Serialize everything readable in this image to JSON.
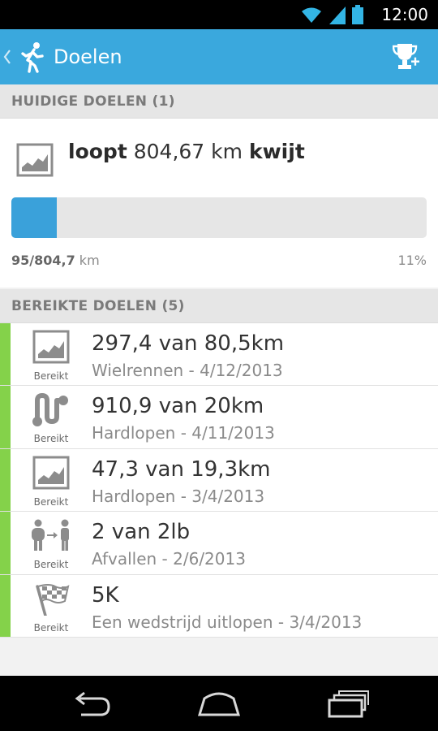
{
  "status_bar": {
    "time": "12:00"
  },
  "action_bar": {
    "title": "Doelen"
  },
  "current_section": {
    "header": "HUIDIGE DOELEN (1)"
  },
  "current_goal": {
    "verb": "loopt",
    "distance": "804,67 km",
    "suffix": "kwijt",
    "progress_done": "95",
    "progress_total": "/804,7",
    "progress_unit": " km",
    "progress_percent": "11%",
    "progress_fraction": 0.11
  },
  "achieved_section": {
    "header": "BEREIKTE DOELEN (5)"
  },
  "achieved": [
    {
      "icon": "chart-icon",
      "badge": "Bereikt",
      "value": "297,4 van 80,5km",
      "sub": "Wielrennen - 4/12/2013"
    },
    {
      "icon": "route-icon",
      "badge": "Bereikt",
      "value": "910,9 van 20km",
      "sub": "Hardlopen - 4/11/2013"
    },
    {
      "icon": "chart-icon",
      "badge": "Bereikt",
      "value": "47,3 van 19,3km",
      "sub": "Hardlopen - 3/4/2013"
    },
    {
      "icon": "weight-loss-icon",
      "badge": "Bereikt",
      "value": "2 van 2lb",
      "sub": "Afvallen - 2/6/2013"
    },
    {
      "icon": "checkered-flag-icon",
      "badge": "Bereikt",
      "value": "5K",
      "sub": "Een wedstrijd uitlopen - 3/4/2013"
    }
  ],
  "colors": {
    "action_bar": "#3aa8dd",
    "progress": "#3aa1da",
    "achieved_stripe": "#84d24a"
  }
}
